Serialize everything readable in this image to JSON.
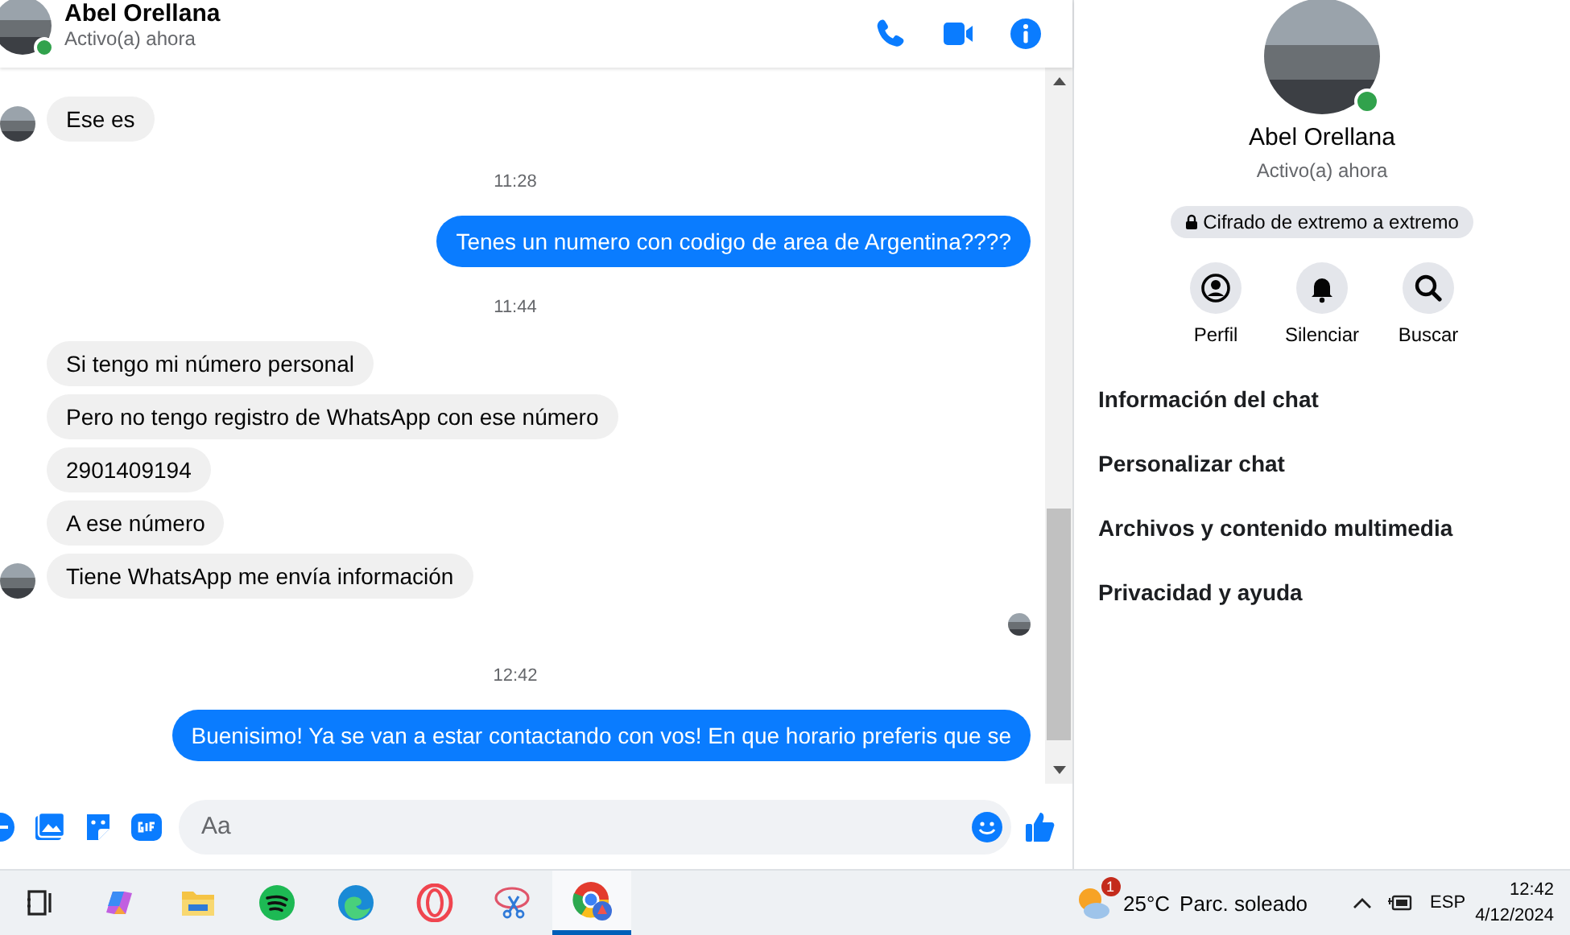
{
  "header": {
    "name": "Abel Orellana",
    "status": "Activo(a) ahora",
    "online": true
  },
  "messages": [
    {
      "kind": "incoming",
      "text": "Ese es",
      "avatar": true
    },
    {
      "kind": "timestamp",
      "text": "11:28"
    },
    {
      "kind": "outgoing",
      "text": "Tenes un numero con codigo de area de Argentina????"
    },
    {
      "kind": "timestamp",
      "text": "11:44"
    },
    {
      "kind": "incoming",
      "text": "Si tengo mi número personal",
      "avatar": false
    },
    {
      "kind": "incoming",
      "text": "Pero no tengo registro de WhatsApp con ese número",
      "avatar": false
    },
    {
      "kind": "incoming",
      "text": "2901409194",
      "avatar": false
    },
    {
      "kind": "incoming",
      "text": "A ese número",
      "avatar": false
    },
    {
      "kind": "incoming",
      "text": "Tiene WhatsApp me envía información",
      "avatar": true
    },
    {
      "kind": "seen"
    },
    {
      "kind": "timestamp",
      "text": "12:42"
    },
    {
      "kind": "outgoing",
      "text": "Buenisimo! Ya se van a estar contactando con vos! En que horario preferis que se"
    }
  ],
  "composer": {
    "placeholder": "Aa"
  },
  "profile": {
    "name": "Abel Orellana",
    "status": "Activo(a) ahora",
    "online": true,
    "encryption": "Cifrado de extremo a extremo",
    "actions": [
      {
        "kind": "profile",
        "label": "Perfil"
      },
      {
        "kind": "mute",
        "label": "Silenciar"
      },
      {
        "kind": "search",
        "label": "Buscar"
      }
    ],
    "menu": [
      "Información del chat",
      "Personalizar chat",
      "Archivos y contenido multimedia",
      "Privacidad y ayuda"
    ]
  },
  "taskbar": {
    "apps": [
      {
        "kind": "taskview",
        "selected": false
      },
      {
        "kind": "copilot",
        "selected": false
      },
      {
        "kind": "files",
        "selected": false
      },
      {
        "kind": "music",
        "selected": false
      },
      {
        "kind": "edge",
        "selected": false
      },
      {
        "kind": "opera",
        "selected": false
      },
      {
        "kind": "snip",
        "selected": false
      },
      {
        "kind": "chrome",
        "selected": true
      }
    ],
    "weather": {
      "badge": "1",
      "temp": "25°C",
      "text": "Parc. soleado"
    },
    "language": "ESP",
    "time": "12:42",
    "date": "4/12/2024"
  }
}
